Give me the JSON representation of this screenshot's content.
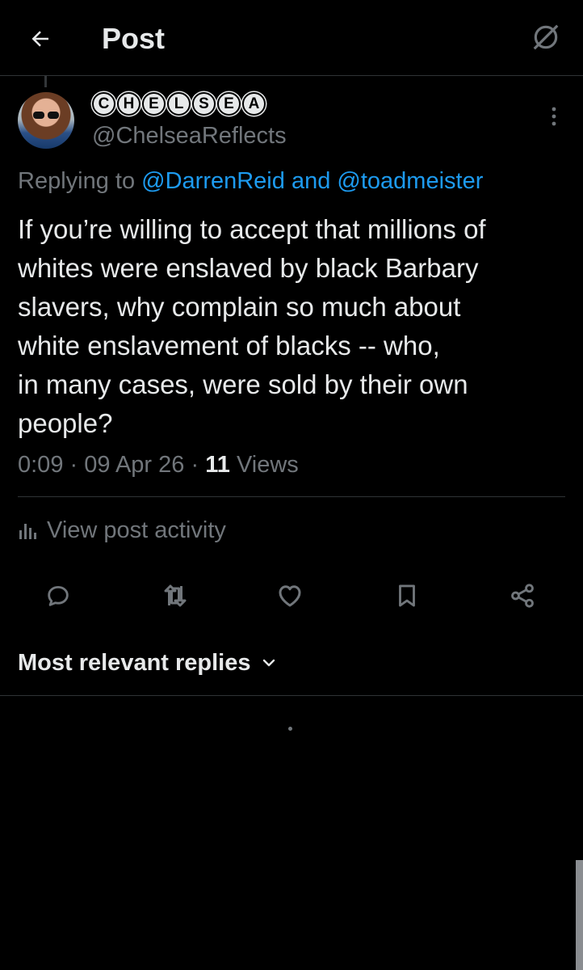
{
  "header": {
    "title": "Post",
    "back_icon": "arrow-left-icon",
    "right_icon": "no-sign-icon"
  },
  "post": {
    "display_name_letters": [
      "C",
      "H",
      "E",
      "L",
      "S",
      "E",
      "A"
    ],
    "handle": "@ChelseaReflects",
    "replying_prefix": "Replying to",
    "reply_user_1": "@DarrenReid",
    "reply_and": "and",
    "reply_user_2": "@toadmeister",
    "body_lines": [
      "If you’re willing to accept that millions of",
      "whites were enslaved by black Barbary",
      "slavers, why complain so much about",
      "white enslavement of blacks -- who,",
      "in many cases, were sold by their own",
      "people?"
    ],
    "time": "0:09",
    "date": "09 Apr 26",
    "separator": "·",
    "views_count": "11",
    "views_label": "Views",
    "activity_label": "View post activity"
  },
  "actions": [
    "reply-icon",
    "repost-icon",
    "like-icon",
    "bookmark-icon",
    "share-icon"
  ],
  "replies_sort": {
    "label": "Most relevant replies"
  },
  "colors": {
    "background": "#000000",
    "text": "#e7e9ea",
    "muted": "#71767b",
    "link": "#1d9bf0",
    "border": "#2f3336"
  }
}
